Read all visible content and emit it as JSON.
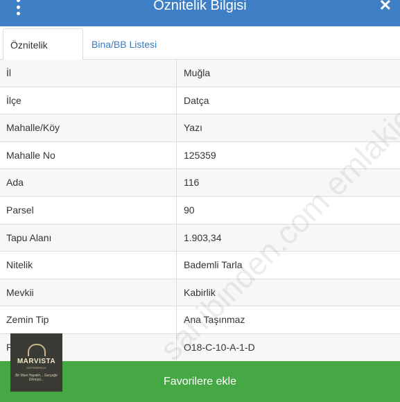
{
  "header": {
    "title": "Öznitelik Bilgisi",
    "menu_icon": "kebab-menu-icon",
    "close_icon": "close-icon"
  },
  "tabs": [
    {
      "label": "Öznitelik Bilgisi",
      "active": true
    },
    {
      "label": "Bina/BB Listesi",
      "active": false
    }
  ],
  "rows": [
    {
      "label": "İl",
      "value": "Muğla"
    },
    {
      "label": "İlçe",
      "value": "Datça"
    },
    {
      "label": "Mahalle/Köy",
      "value": "Yazı"
    },
    {
      "label": "Mahalle No",
      "value": "125359"
    },
    {
      "label": "Ada",
      "value": "116"
    },
    {
      "label": "Parsel",
      "value": "90"
    },
    {
      "label": "Tapu Alanı",
      "value": "1.903,34"
    },
    {
      "label": "Nitelik",
      "value": "Bademli Tarla"
    },
    {
      "label": "Mevkii",
      "value": "Kabirlik"
    },
    {
      "label": "Zemin Tip",
      "value": "Ana Taşınmaz"
    },
    {
      "label": "Pafta",
      "value": "O18-C-10-A-1-D"
    }
  ],
  "footer": {
    "button_label": "Favorilere ekle"
  },
  "watermark": "sahibinden.com emlakjet.com",
  "logo": {
    "name": "MARVISTA",
    "sub": "GAYRIMENKUL",
    "tagline": "Bir Mavi Hayalin... Gerçeğe Dönüşü..."
  },
  "colors": {
    "header": "#3f7fc5",
    "tab_link": "#3a7bc0",
    "footer_button": "#45a845"
  }
}
